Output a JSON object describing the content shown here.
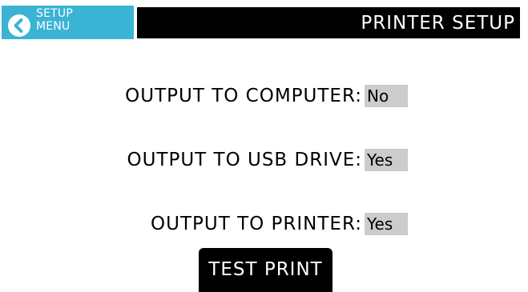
{
  "header": {
    "back_button": {
      "line1": "SETUP",
      "line2": "MENU",
      "icon": "chevron-left-icon",
      "color": "#3bb3d4"
    },
    "title": "PRINTER SETUP"
  },
  "settings": [
    {
      "label": "OUTPUT TO COMPUTER:",
      "value": "No"
    },
    {
      "label": "OUTPUT TO USB DRIVE:",
      "value": "Yes"
    },
    {
      "label": "OUTPUT TO PRINTER:",
      "value": "Yes"
    }
  ],
  "test_print_button": {
    "label": "TEST PRINT"
  },
  "colors": {
    "value_background": "#cccccc",
    "bar_background": "#000000"
  }
}
